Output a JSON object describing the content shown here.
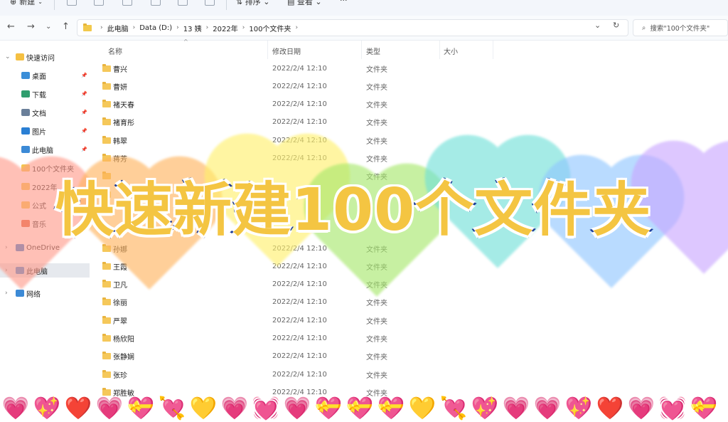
{
  "toolbar": {
    "new_label": "新建",
    "sort_label": "排序",
    "view_label": "查看",
    "more_label": "···"
  },
  "nav": {
    "back": "←",
    "forward": "→",
    "recent": "⌄",
    "up": "↑"
  },
  "breadcrumb": [
    "此电脑",
    "Data (D:)",
    "13 姨",
    "2022年",
    "100个文件夹"
  ],
  "search": {
    "placeholder": "搜索\"100个文件夹\""
  },
  "sidebar": {
    "items": [
      {
        "label": "快速访问",
        "icon": "star-icon",
        "color": "#f5c042",
        "pinned": false,
        "indent": 0,
        "chev": "⌄"
      },
      {
        "label": "桌面",
        "icon": "desktop-icon",
        "color": "#3b8ed8",
        "pinned": true,
        "indent": 1
      },
      {
        "label": "下载",
        "icon": "download-icon",
        "color": "#2f9e6e",
        "pinned": true,
        "indent": 1
      },
      {
        "label": "文档",
        "icon": "document-icon",
        "color": "#6a7f99",
        "pinned": true,
        "indent": 1
      },
      {
        "label": "图片",
        "icon": "picture-icon",
        "color": "#2a7fd4",
        "pinned": true,
        "indent": 1
      },
      {
        "label": "此电脑",
        "icon": "computer-icon",
        "color": "#3c8ad6",
        "pinned": true,
        "indent": 1
      },
      {
        "label": "100个文件夹",
        "icon": "folder-icon",
        "color": "#f2c94c",
        "pinned": false,
        "indent": 1
      },
      {
        "label": "2022年",
        "icon": "folder-icon",
        "color": "#f2c94c",
        "pinned": false,
        "indent": 1
      },
      {
        "label": "公式",
        "icon": "folder-icon",
        "color": "#f2c94c",
        "pinned": false,
        "indent": 1
      },
      {
        "label": "音乐",
        "icon": "music-icon",
        "color": "#e0623a",
        "pinned": false,
        "indent": 1
      },
      {
        "label": "OneDrive",
        "icon": "cloud-icon",
        "color": "#2f7fd6",
        "pinned": false,
        "indent": 0,
        "chev": "›"
      },
      {
        "label": "此电脑",
        "icon": "computer-icon",
        "color": "#3c8ad6",
        "pinned": false,
        "indent": 0,
        "chev": "›",
        "active": true
      },
      {
        "label": "网络",
        "icon": "network-icon",
        "color": "#3c8ad6",
        "pinned": false,
        "indent": 0,
        "chev": "›"
      }
    ]
  },
  "columns": {
    "name": "名称",
    "modified": "修改日期",
    "type": "类型",
    "size": "大小"
  },
  "files": [
    {
      "name": "曹兴",
      "modified": "2022/2/4 12:10",
      "type": "文件夹"
    },
    {
      "name": "曹妍",
      "modified": "2022/2/4 12:10",
      "type": "文件夹"
    },
    {
      "name": "褚天春",
      "modified": "2022/2/4 12:10",
      "type": "文件夹"
    },
    {
      "name": "褚育彤",
      "modified": "2022/2/4 12:10",
      "type": "文件夹"
    },
    {
      "name": "韩翠",
      "modified": "2022/2/4 12:10",
      "type": "文件夹"
    },
    {
      "name": "蒋芳",
      "modified": "2022/2/4 12:10",
      "type": "文件夹"
    },
    {
      "name": "",
      "modified": "",
      "type": "文件夹"
    },
    {
      "name": "",
      "modified": "",
      "type": ""
    },
    {
      "name": "",
      "modified": "",
      "type": ""
    },
    {
      "name": "",
      "modified": "",
      "type": ""
    },
    {
      "name": "孙娜",
      "modified": "2022/2/4 12:10",
      "type": "文件夹"
    },
    {
      "name": "王霞",
      "modified": "2022/2/4 12:10",
      "type": "文件夹"
    },
    {
      "name": "卫凡",
      "modified": "2022/2/4 12:10",
      "type": "文件夹"
    },
    {
      "name": "徐丽",
      "modified": "2022/2/4 12:10",
      "type": "文件夹"
    },
    {
      "name": "严翠",
      "modified": "2022/2/4 12:10",
      "type": "文件夹"
    },
    {
      "name": "杨欣阳",
      "modified": "2022/2/4 12:10",
      "type": "文件夹"
    },
    {
      "name": "张静娴",
      "modified": "2022/2/4 12:10",
      "type": "文件夹"
    },
    {
      "name": "张珍",
      "modified": "2022/2/4 12:10",
      "type": "文件夹"
    },
    {
      "name": "郑胜敏",
      "modified": "2022/2/4 12:10",
      "type": "文件夹"
    }
  ],
  "overlay": {
    "headline": "快速新建100个文件夹",
    "heart_colors": [
      "#ff9a8a",
      "#ffb35c",
      "#fff06a",
      "#a6e86a",
      "#6fe0d8",
      "#8fc6ff",
      "#c9a6ff"
    ]
  },
  "emoji_strip": [
    "💗",
    "💖",
    "❤️",
    "💗",
    "💝",
    "💘",
    "💛",
    "💗",
    "💓",
    "💗",
    "💝",
    "💝",
    "💝",
    "💛",
    "💘",
    "💖",
    "💗",
    "💗",
    "💖",
    "❤️",
    "💗",
    "💓",
    "💝"
  ]
}
